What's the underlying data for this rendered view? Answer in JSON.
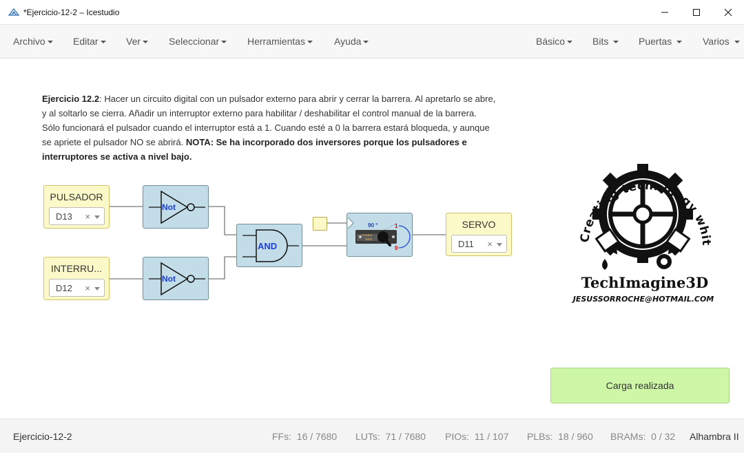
{
  "window": {
    "title": "*Ejercicio-12-2 – Icestudio"
  },
  "menu": {
    "left": [
      "Archivo",
      "Editar",
      "Ver",
      "Seleccionar",
      "Herramientas",
      "Ayuda"
    ],
    "right": [
      "Básico",
      "Bits",
      "Puertas",
      "Varios"
    ]
  },
  "description": {
    "heading": "Ejercicio 12.2",
    "text": ": Hacer un circuito digital con un pulsador externo para abrir y cerrar la barrera. Al apretarlo se abre, y al soltarlo se cierra. Añadir un interruptor externo para habilitar / deshabilitar el control manual de la barrera. Sólo funcionará el pulsador cuando el interruptor está a 1. Cuando esté a 0 la barrera estará bloqueda, y aunque se apriete el pulsador NO se abrirá. ",
    "note": "NOTA: Se ha incorporado dos inversores porque los pulsadores e interruptores se activa a nivel bajo."
  },
  "circuit": {
    "input1": {
      "label": "PULSADOR",
      "pin": "D13"
    },
    "input2": {
      "label": "INTERRU...",
      "pin": "D12"
    },
    "not1": "Not",
    "not2": "Not",
    "and": "AND",
    "servo_block": {
      "angle": "90 °",
      "high": "1",
      "low": "0",
      "brand": "Futaba",
      "model": "3003"
    },
    "output": {
      "label": "SERVO",
      "pin": "D11"
    },
    "clear_glyph": "×"
  },
  "logo": {
    "arc_text": "Creating technology whith imagination",
    "brand": "TechImagine3D",
    "email": "JESUSSORROCHE@HOTMAIL.COM"
  },
  "toast": "Carga realizada",
  "status": {
    "project": "Ejercicio-12-2",
    "ffs_label": "FFs:",
    "ffs": "16 / 7680",
    "luts_label": "LUTs:",
    "luts": "71 / 7680",
    "pios_label": "PIOs:",
    "pios": "11 / 107",
    "plbs_label": "PLBs:",
    "plbs": "18 / 960",
    "brams_label": "BRAMs:",
    "brams": "0 / 32",
    "board": "Alhambra II"
  },
  "colors": {
    "io_fill": "#fcf9c8",
    "gate_fill": "#c2dde8",
    "toast_fill": "#cdf7a6",
    "gate_text": "#1a3fd1"
  }
}
